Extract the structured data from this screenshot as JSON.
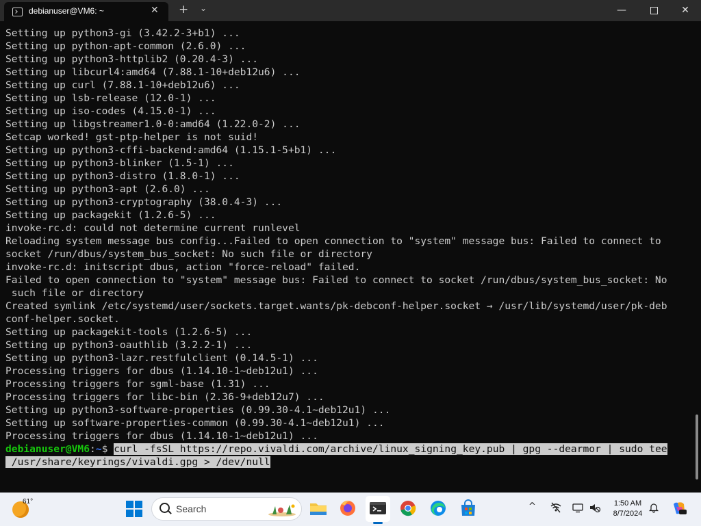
{
  "window": {
    "tab_title": "debianuser@VM6: ~",
    "tab_close": "✕",
    "new_tab": "+",
    "dropdown": "⌄",
    "minimize": "—",
    "close": "✕"
  },
  "terminal": {
    "lines": [
      "Setting up python3-gi (3.42.2-3+b1) ...",
      "Setting up python-apt-common (2.6.0) ...",
      "Setting up python3-httplib2 (0.20.4-3) ...",
      "Setting up libcurl4:amd64 (7.88.1-10+deb12u6) ...",
      "Setting up curl (7.88.1-10+deb12u6) ...",
      "Setting up lsb-release (12.0-1) ...",
      "Setting up iso-codes (4.15.0-1) ...",
      "Setting up libgstreamer1.0-0:amd64 (1.22.0-2) ...",
      "Setcap worked! gst-ptp-helper is not suid!",
      "Setting up python3-cffi-backend:amd64 (1.15.1-5+b1) ...",
      "Setting up python3-blinker (1.5-1) ...",
      "Setting up python3-distro (1.8.0-1) ...",
      "Setting up python3-apt (2.6.0) ...",
      "Setting up python3-cryptography (38.0.4-3) ...",
      "Setting up packagekit (1.2.6-5) ...",
      "invoke-rc.d: could not determine current runlevel",
      "Reloading system message bus config...Failed to open connection to \"system\" message bus: Failed to connect to",
      "socket /run/dbus/system_bus_socket: No such file or directory",
      "invoke-rc.d: initscript dbus, action \"force-reload\" failed.",
      "Failed to open connection to \"system\" message bus: Failed to connect to socket /run/dbus/system_bus_socket: No",
      " such file or directory",
      "Created symlink /etc/systemd/user/sockets.target.wants/pk-debconf-helper.socket → /usr/lib/systemd/user/pk-deb",
      "conf-helper.socket.",
      "Setting up packagekit-tools (1.2.6-5) ...",
      "Setting up python3-oauthlib (3.2.2-1) ...",
      "Setting up python3-lazr.restfulclient (0.14.5-1) ...",
      "Processing triggers for dbus (1.14.10-1~deb12u1) ...",
      "Processing triggers for sgml-base (1.31) ...",
      "Processing triggers for libc-bin (2.36-9+deb12u7) ...",
      "Setting up python3-software-properties (0.99.30-4.1~deb12u1) ...",
      "Setting up software-properties-common (0.99.30-4.1~deb12u1) ...",
      "Processing triggers for dbus (1.14.10-1~deb12u1) ..."
    ],
    "prompt_user": "debianuser@VM6",
    "prompt_sep": ":",
    "prompt_path": "~",
    "prompt_symbol": "$ ",
    "command_line1": "curl -fsSL https://repo.vivaldi.com/archive/linux_signing_key.pub | gpg --dearmor | sudo tee",
    "command_line2": " /usr/share/keyrings/vivaldi.gpg > /dev/null"
  },
  "taskbar": {
    "temperature": "61°",
    "search_label": "Search",
    "time": "1:50 AM",
    "date": "8/7/2024",
    "tray_chevron": "^"
  },
  "colors": {
    "terminal_bg": "#0c0c0c",
    "terminal_fg": "#cccccc",
    "prompt_user": "#16c60c",
    "prompt_path": "#3b78ff",
    "taskbar_bg": "#eef1f7",
    "accent": "#0078d4"
  },
  "icons": {
    "tab": "terminal-icon",
    "weather": "weather-sun-icon",
    "start": "windows-start-icon",
    "search": "search-icon",
    "apps": [
      "file-explorer-icon",
      "firefox-icon",
      "terminal-icon",
      "chrome-icon",
      "edge-icon",
      "microsoft-store-icon"
    ],
    "tray": [
      "chevron-up-icon",
      "network-icon",
      "display-icon",
      "volume-icon",
      "notification-bell-icon",
      "copilot-icon"
    ]
  }
}
